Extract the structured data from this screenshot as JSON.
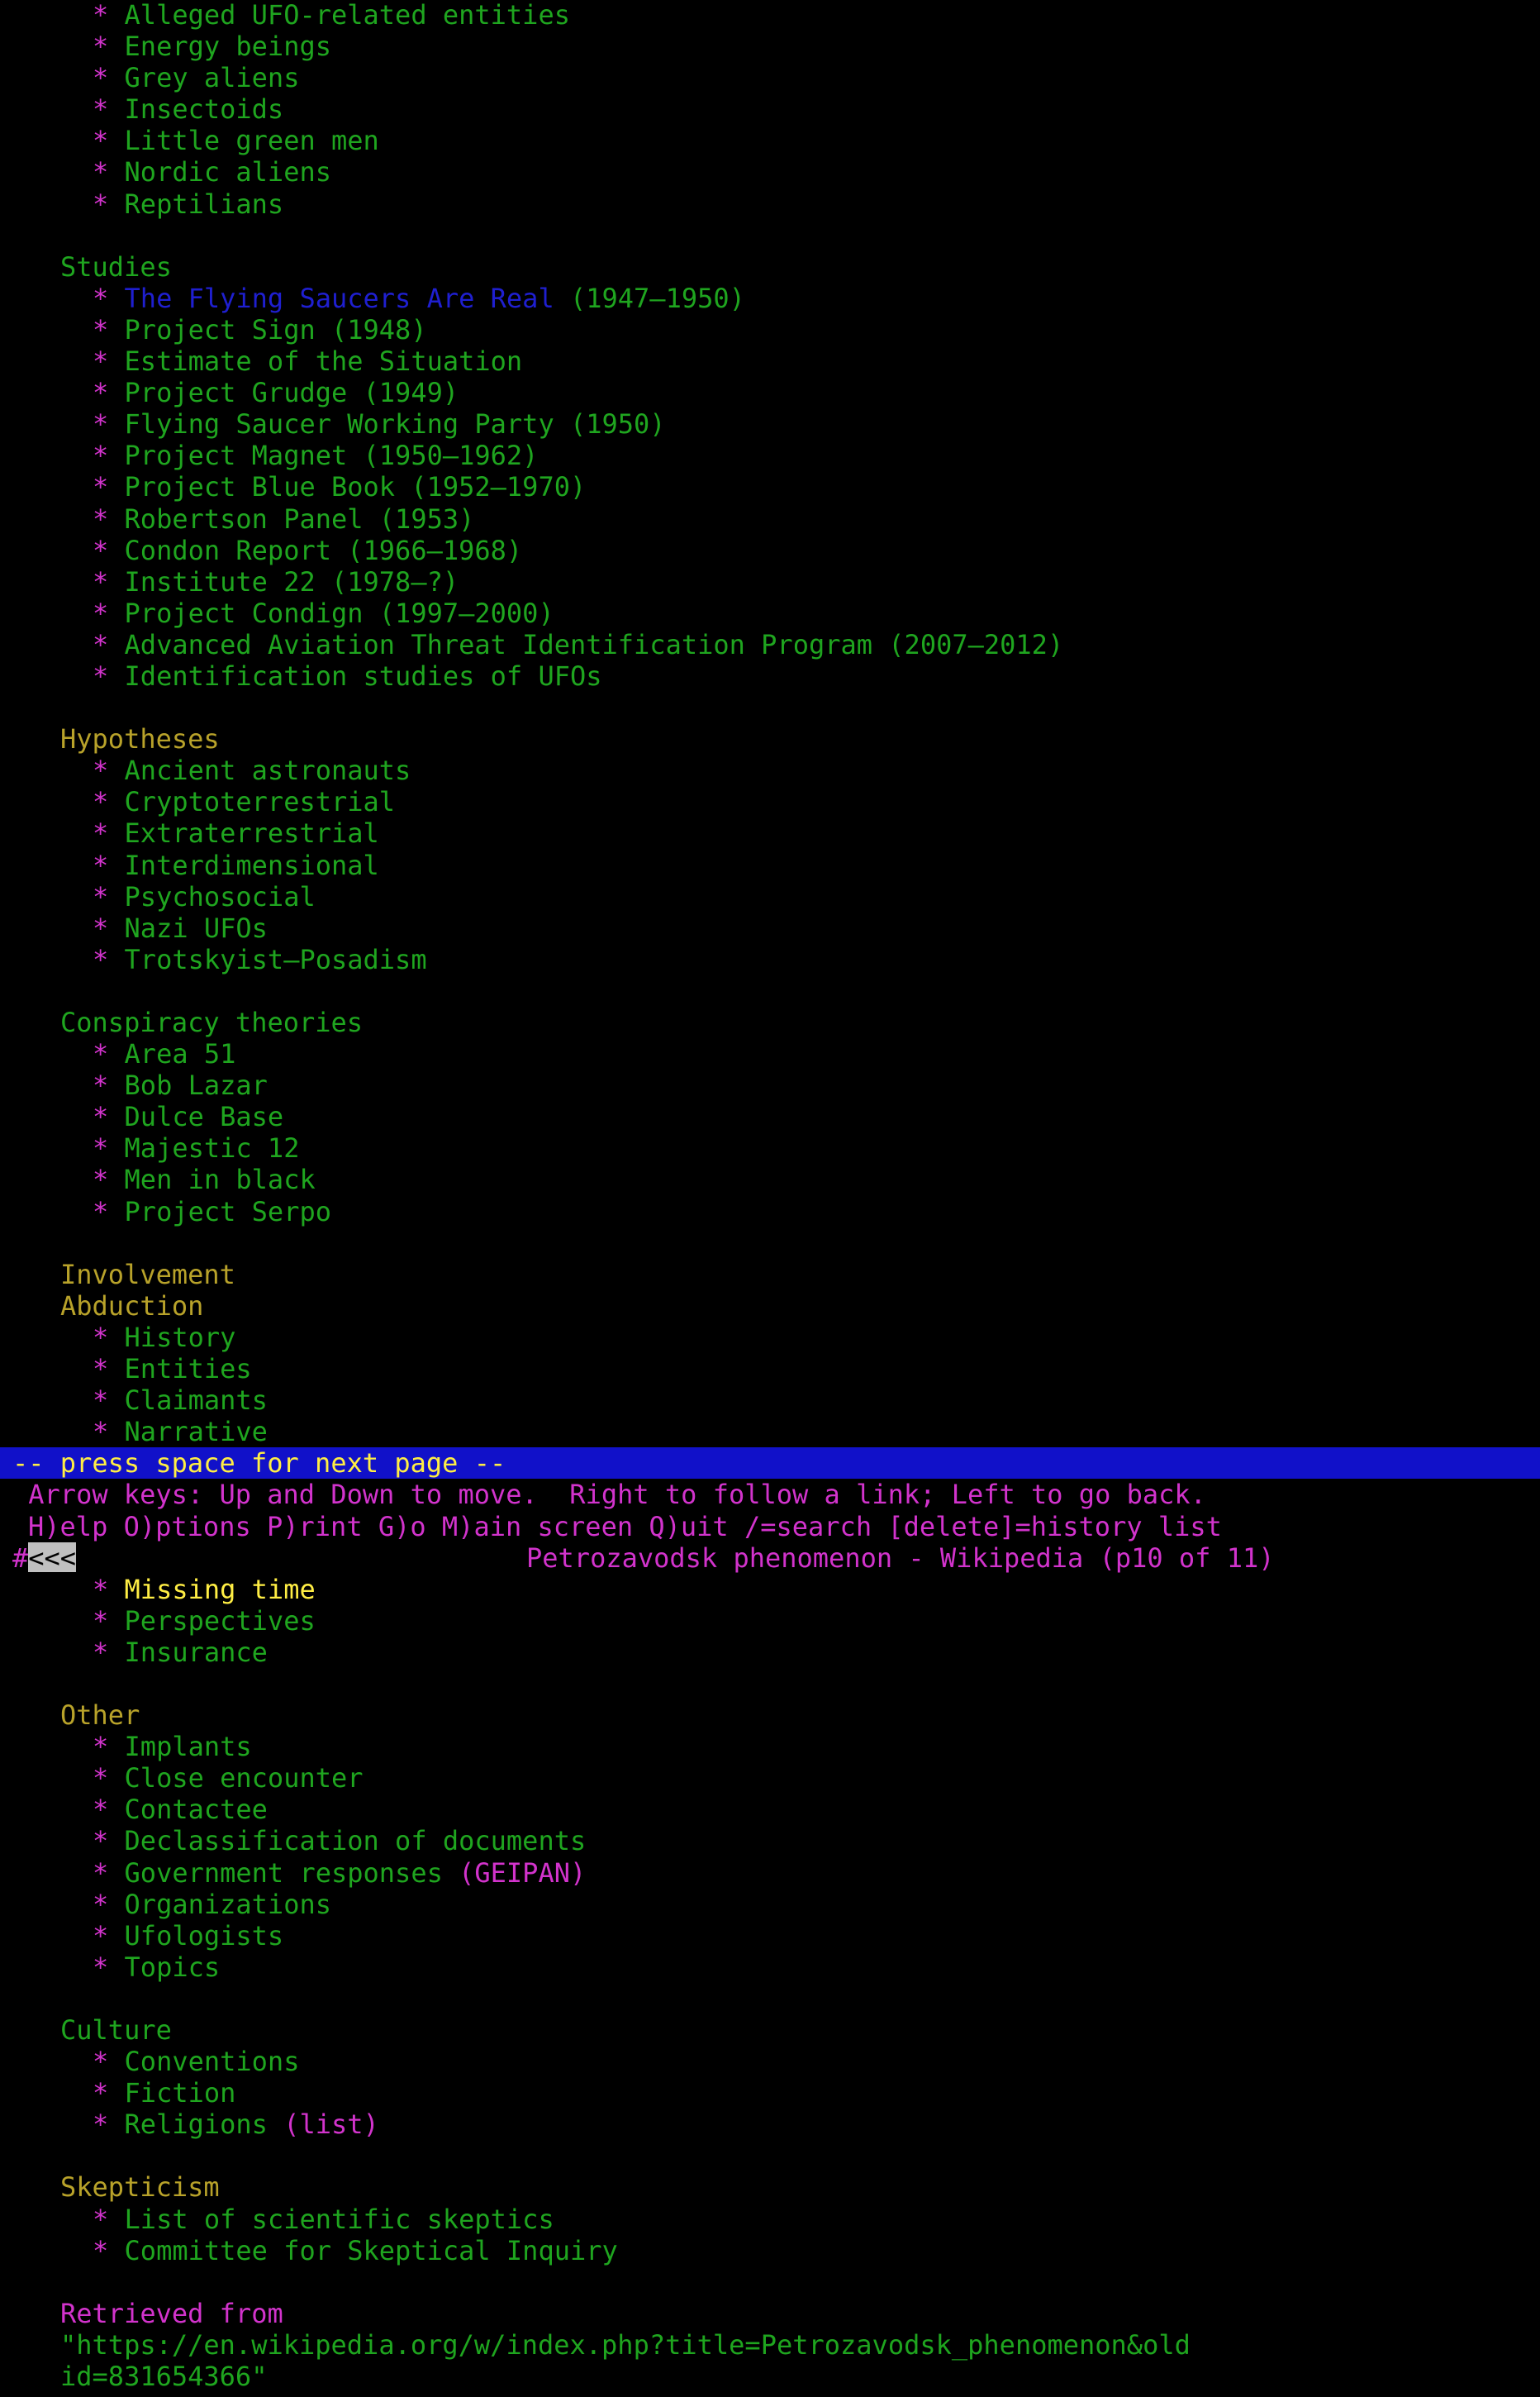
{
  "window": {
    "app": "Lynx text browser"
  },
  "page_top": {
    "entities_items": [
      "Alleged UFO-related entities",
      "Energy beings",
      "Grey aliens",
      "Insectoids",
      "Little green men",
      "Nordic aliens",
      "Reptilians"
    ],
    "studies_heading": "Studies",
    "studies_first_link": "The Flying Saucers Are Real",
    "studies_first_suffix": " (1947–1950)",
    "studies_items": [
      "Project Sign (1948)",
      "Estimate of the Situation",
      "Project Grudge (1949)",
      "Flying Saucer Working Party (1950)",
      "Project Magnet (1950–1962)",
      "Project Blue Book (1952–1970)",
      "Robertson Panel (1953)",
      "Condon Report (1966–1968)",
      "Institute 22 (1978–?)",
      "Project Condign (1997–2000)",
      "Advanced Aviation Threat Identification Program (2007–2012)",
      "Identification studies of UFOs"
    ],
    "hypotheses_heading": "Hypotheses",
    "hypotheses_items": [
      "Ancient astronauts",
      "Cryptoterrestrial",
      "Extraterrestrial",
      "Interdimensional",
      "Psychosocial",
      "Nazi UFOs",
      "Trotskyist–Posadism"
    ],
    "conspiracy_heading": "Conspiracy theories",
    "conspiracy_items": [
      "Area 51",
      "Bob Lazar",
      "Dulce Base",
      "Majestic 12",
      "Men in black",
      "Project Serpo"
    ],
    "involvement_heading": "Involvement",
    "abduction_heading": "Abduction",
    "abduction_items": [
      "History",
      "Entities",
      "Claimants",
      "Narrative"
    ]
  },
  "status": {
    "press_space": "-- press space for next page --",
    "arrow_help": " Arrow keys: Up and Down to move.  Right to follow a link; Left to go back.",
    "command_help": "H)elp O)ptions P)rint G)o M)ain screen Q)uit /=search [delete]=history list",
    "hash": "#",
    "back_label": "<<<",
    "page_title": "Petrozavodsk phenomenon - Wikipedia (p10 of 11)"
  },
  "page_bottom": {
    "abduction_more_selected": "Missing time",
    "abduction_more_items": [
      "Perspectives",
      "Insurance"
    ],
    "other_heading": "Other",
    "other_items_a": [
      "Implants",
      "Close encounter",
      "Contactee",
      "Declassification of documents"
    ],
    "gov_responses": "Government responses ",
    "gov_geipan": "(GEIPAN)",
    "other_items_b": [
      "Organizations",
      "Ufologists",
      "Topics"
    ],
    "culture_heading": "Culture",
    "culture_items": [
      "Conventions",
      "Fiction"
    ],
    "religions": "Religions ",
    "religions_list": "(list)",
    "skepticism_heading": "Skepticism",
    "skepticism_items": [
      "List of scientific skeptics",
      "Committee for Skeptical Inquiry"
    ],
    "retrieved_label": "Retrieved from",
    "retrieved_url_line1": "\"https://en.wikipedia.org/w/index.php?title=Petrozavodsk_phenomenon&old",
    "retrieved_url_line2": "id=831654366\""
  },
  "colors": {
    "background": "#000000",
    "text_green": "#1fa51f",
    "heading_olive": "#b8a22a",
    "link_blue": "#1f1fd0",
    "highlight_yellow": "#ffee44",
    "magenta": "#d233cc",
    "statusbar_blue": "#1111c9"
  }
}
